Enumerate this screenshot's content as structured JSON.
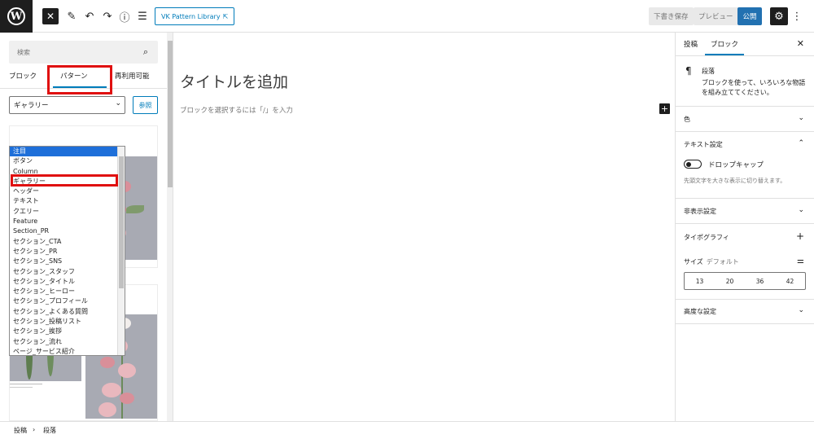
{
  "topbar": {
    "vk_button_label": "VK Pattern Library",
    "save_draft_label": "下書き保存",
    "preview_label": "プレビュー",
    "publish_label": "公開"
  },
  "inserter": {
    "search_placeholder": "検索",
    "tabs": [
      "ブロック",
      "パターン",
      "再利用可能"
    ],
    "category_selected": "ギャラリー",
    "browse_label": "参照",
    "category_options": [
      "注目",
      "ボタン",
      "Column",
      "ギャラリー",
      "ヘッダー",
      "テキスト",
      "クエリー",
      "Feature",
      "Section_PR",
      "セクション_CTA",
      "セクション_PR",
      "セクション_SNS",
      "セクション_スタッフ",
      "セクション_タイトル",
      "セクション_ヒーロー",
      "セクション_プロフィール",
      "セクション_よくある質問",
      "セクション_投稿リスト",
      "セクション_挨拶",
      "セクション_流れ",
      "ページ_サービス紹介"
    ]
  },
  "canvas": {
    "title_placeholder": "タイトルを追加",
    "block_placeholder": "ブロックを選択するには「/」を入力"
  },
  "sidebar": {
    "tabs": [
      "投稿",
      "ブロック"
    ],
    "block_name": "段落",
    "block_description": "ブロックを使って、いろいろな物語を組み立ててください。",
    "sections": {
      "color": "色",
      "text_settings": "テキスト設定",
      "drop_cap": "ドロップキャップ",
      "drop_cap_help": "先頭文字を大きな表示に切り替えます。",
      "hidden_settings": "非表示設定",
      "typography": "タイポグラフィ",
      "size_label": "サイズ",
      "size_default": "デフォルト",
      "size_options": [
        "13",
        "20",
        "36",
        "42"
      ],
      "advanced": "高度な設定"
    }
  },
  "breadcrumb": [
    "投稿",
    "段落"
  ],
  "colors": {
    "accent": "#007cba",
    "publish": "#2271b1",
    "highlight": "#e01010",
    "selected_option": "#1e6fd9"
  }
}
